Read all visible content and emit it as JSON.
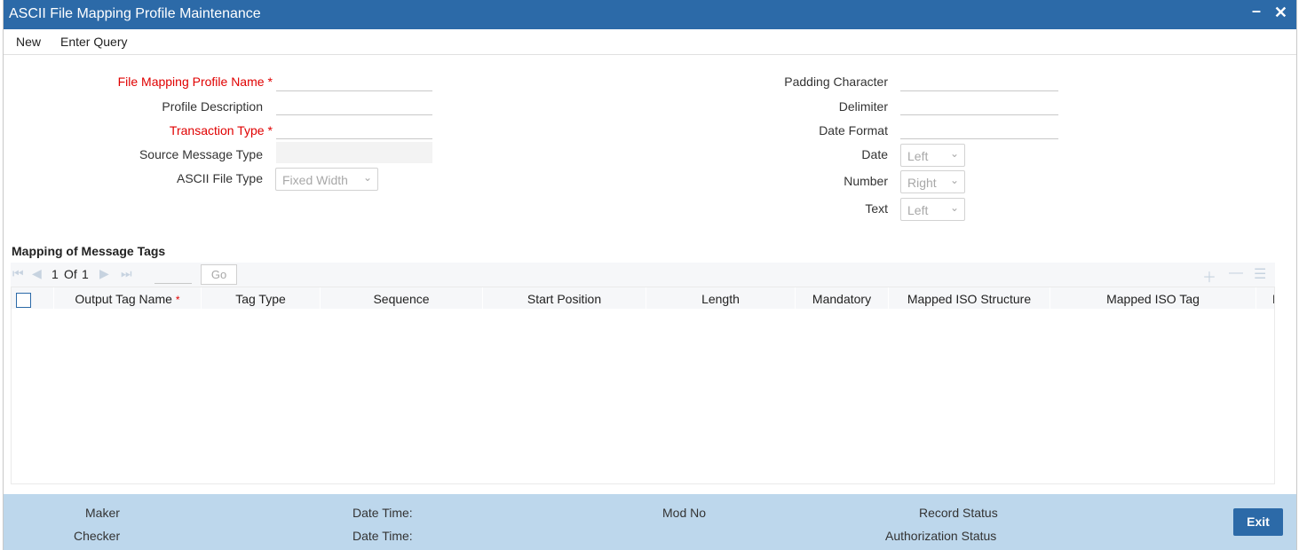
{
  "window": {
    "title": "ASCII File Mapping Profile Maintenance",
    "minimize_icon": "minimize-icon",
    "close_icon": "close-icon"
  },
  "menu": {
    "new": "New",
    "enter_query": "Enter Query"
  },
  "form_left": {
    "profile_name": "File Mapping Profile Name",
    "profile_desc": "Profile Description",
    "txn_type": "Transaction Type",
    "src_msg_type": "Source Message Type",
    "ascii_file_type": "ASCII File Type",
    "ascii_file_type_value": "Fixed Width",
    "required_mark": "*"
  },
  "form_right": {
    "padding_char": "Padding Character",
    "delimiter": "Delimiter",
    "date_format": "Date Format",
    "date": "Date",
    "date_value": "Left",
    "number": "Number",
    "number_value": "Right",
    "text": "Text",
    "text_value": "Left"
  },
  "mapping": {
    "section_title": "Mapping of Message Tags",
    "pager": {
      "current": "1",
      "of_label": "Of",
      "total": "1",
      "go": "Go"
    },
    "columns": [
      "Output Tag Name",
      "Tag Type",
      "Sequence",
      "Start Position",
      "Length",
      "Mandatory",
      "Mapped ISO Structure",
      "Mapped ISO Tag",
      "F"
    ],
    "required_mark": "*"
  },
  "footer": {
    "maker": "Maker",
    "checker": "Checker",
    "date_time_1": "Date Time:",
    "date_time_2": "Date Time:",
    "mod_no": "Mod No",
    "record_status": "Record Status",
    "auth_status": "Authorization Status",
    "exit": "Exit"
  },
  "colors": {
    "accent": "#2c6aa8",
    "required": "#e00000",
    "footer_bg": "#bdd7ec"
  }
}
